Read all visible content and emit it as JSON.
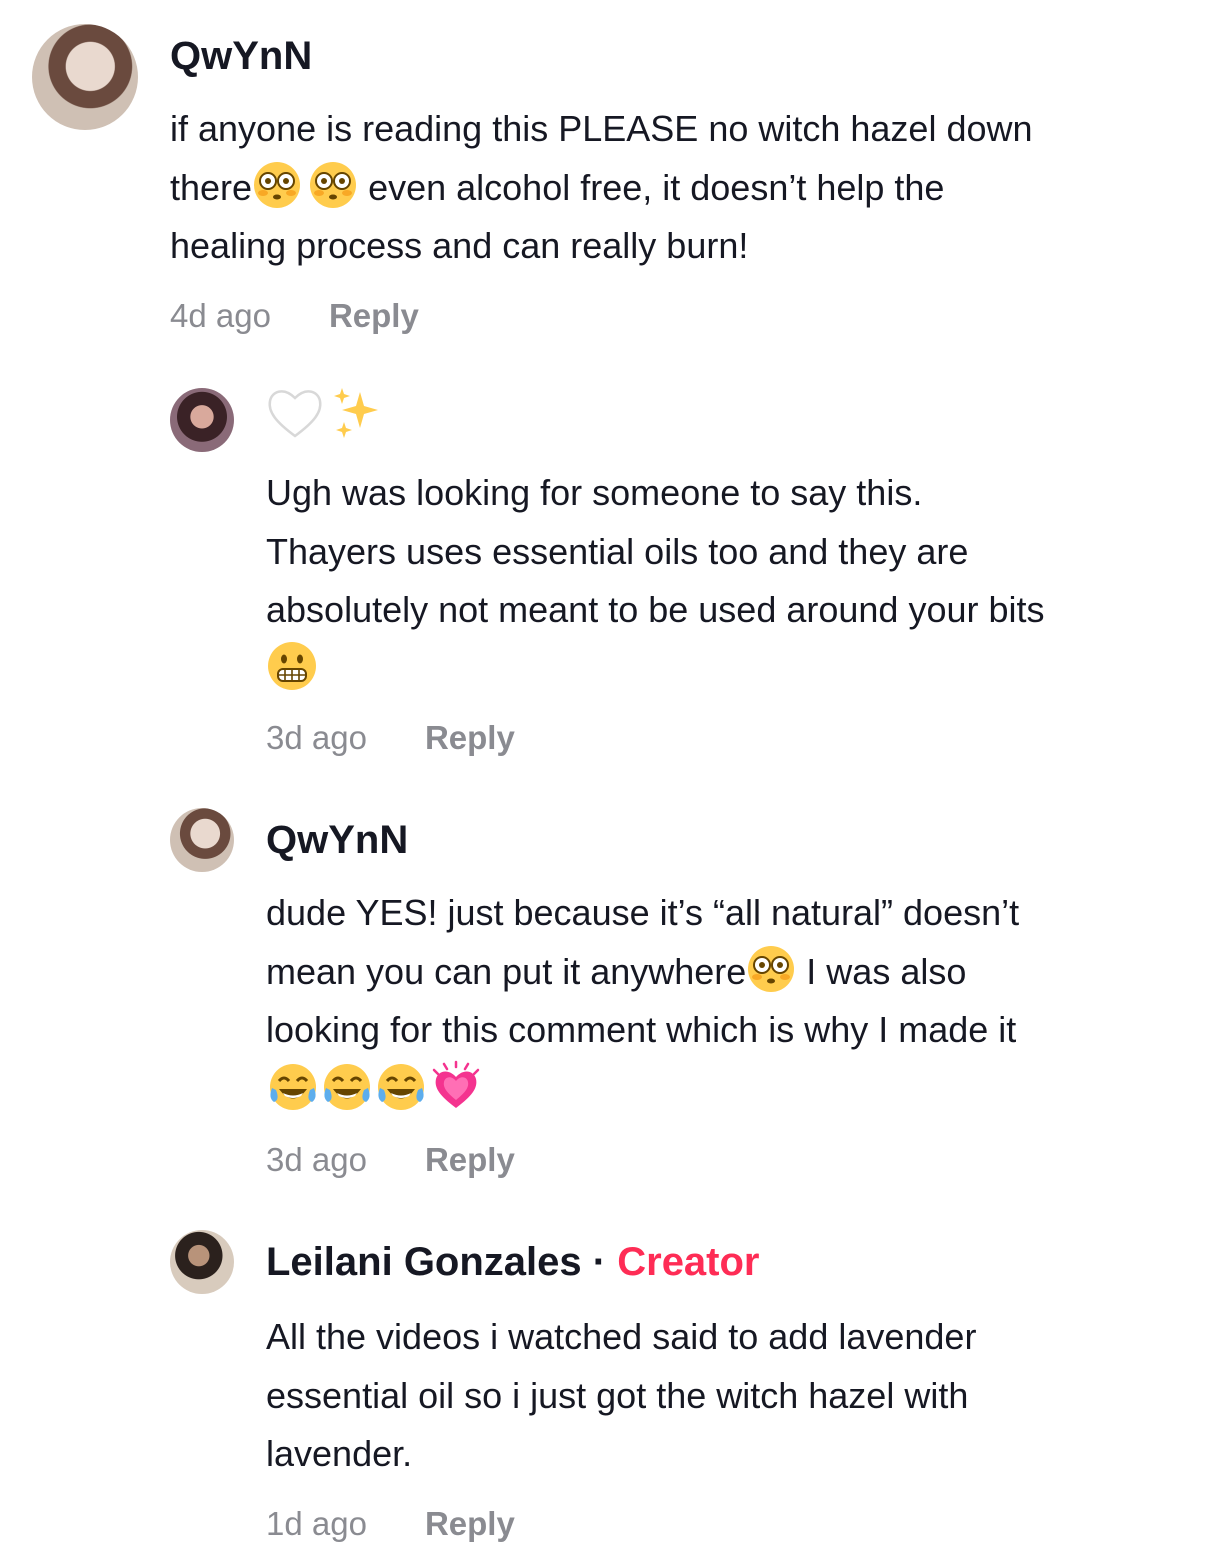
{
  "comments": [
    {
      "username": "QwYnN",
      "text_line1": "if anyone is reading this PLEASE no witch hazel down",
      "text_line2a": "there",
      "text_line2b": " even alcohol free, it doesn’t help the",
      "text_line3": "healing process and can really burn!",
      "time": "4d ago",
      "reply_label": "Reply"
    },
    {
      "username_emojis": [
        "white-heart",
        "sparkles"
      ],
      "text_line1": "Ugh was looking for someone to say this.",
      "text_line2": "Thayers uses essential oils too and they are",
      "text_line3": "absolutely not meant to be used around your bits",
      "time": "3d ago",
      "reply_label": "Reply"
    },
    {
      "username": "QwYnN",
      "text_line1": "dude YES! just because it’s “all natural” doesn’t",
      "text_line2a": "mean you can put it anywhere",
      "text_line2b": " I was also",
      "text_line3": "looking for this comment which is why I made it",
      "time": "3d ago",
      "reply_label": "Reply"
    },
    {
      "username": "Leilani Gonzales",
      "separator": "·",
      "badge": "Creator",
      "text_line1": "All the videos i watched said to add lavender",
      "text_line2": "essential oil so i just got the witch hazel with",
      "text_line3": "lavender.",
      "time": "1d ago",
      "reply_label": "Reply"
    }
  ],
  "colors": {
    "text": "#161823",
    "muted": "#8a8b91",
    "creator": "#fe2c55"
  }
}
